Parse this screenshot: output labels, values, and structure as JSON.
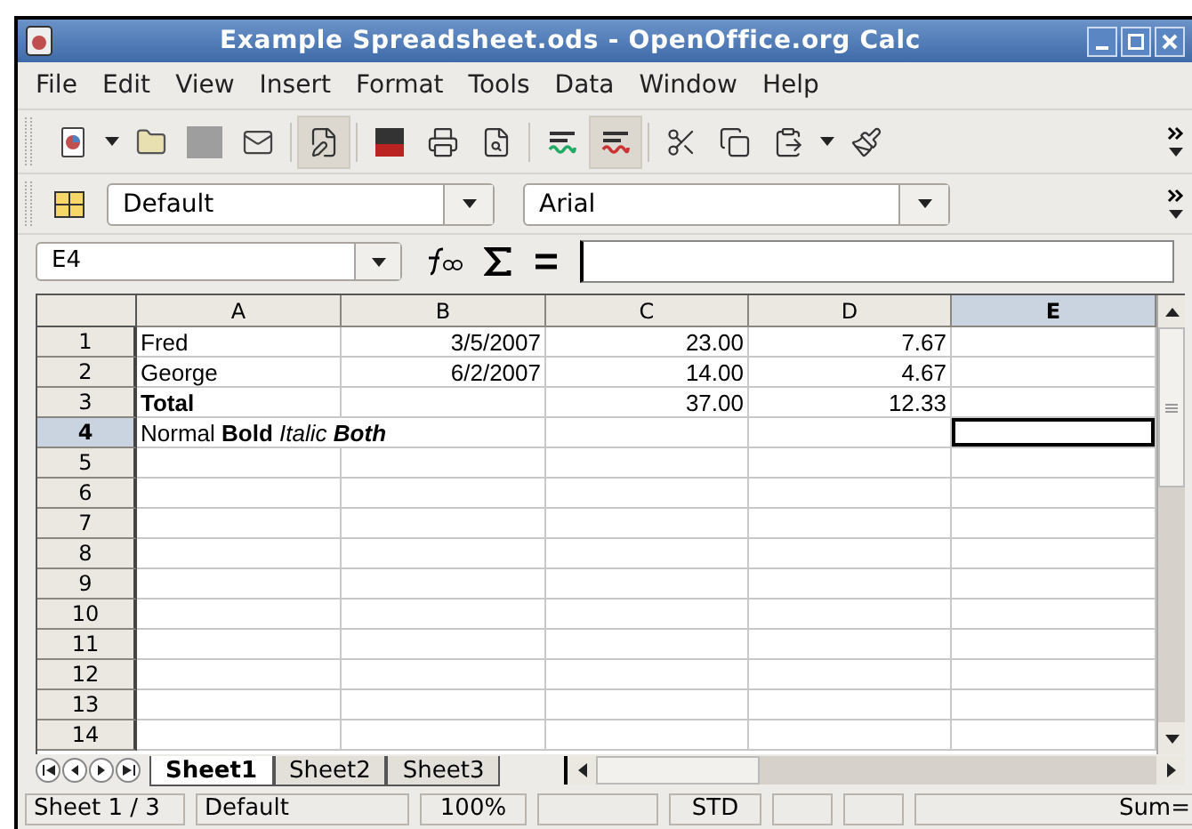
{
  "window": {
    "title": "Example Spreadsheet.ods - OpenOffice.org Calc"
  },
  "menu": [
    "File",
    "Edit",
    "View",
    "Insert",
    "Format",
    "Tools",
    "Data",
    "Window",
    "Help"
  ],
  "toolbar": [
    {
      "pressed": false
    },
    {
      "pressed": false
    },
    {
      "pressed": false
    },
    {
      "pressed": false
    },
    {
      "pressed": false
    },
    {
      "pressed": true
    },
    {
      "pressed": false
    },
    {
      "pressed": false
    },
    {
      "pressed": false
    },
    {
      "pressed": false
    },
    {
      "pressed": true
    },
    {
      "pressed": false
    },
    {
      "pressed": false
    },
    {
      "pressed": false
    },
    {
      "pressed": false
    },
    {
      "pressed": false
    }
  ],
  "format_bar": {
    "style": "Default",
    "font": "Arial"
  },
  "formula_bar": {
    "cell_ref": "E4"
  },
  "columns": [
    {
      "label": "A",
      "selected": false
    },
    {
      "label": "B",
      "selected": false
    },
    {
      "label": "C",
      "selected": false
    },
    {
      "label": "D",
      "selected": false
    },
    {
      "label": "E",
      "selected": true
    }
  ],
  "rows": [
    {
      "label": "1",
      "selected": false,
      "cells": [
        {
          "kind": "text",
          "text": "Fred"
        },
        {
          "kind": "number",
          "text": "3/5/2007"
        },
        {
          "kind": "number",
          "text": "23.00"
        },
        {
          "kind": "number",
          "text": "7.67"
        },
        null
      ]
    },
    {
      "label": "2",
      "selected": false,
      "cells": [
        {
          "kind": "text",
          "text": "George"
        },
        {
          "kind": "number",
          "text": "6/2/2007"
        },
        {
          "kind": "number",
          "text": "14.00"
        },
        {
          "kind": "number",
          "text": "4.67"
        },
        null
      ]
    },
    {
      "label": "3",
      "selected": false,
      "cells": [
        {
          "kind": "text",
          "text": "Total",
          "bold": true
        },
        null,
        {
          "kind": "number",
          "text": "37.00"
        },
        {
          "kind": "number",
          "text": "12.33"
        },
        null
      ]
    },
    {
      "label": "4",
      "selected": true,
      "cells": [
        {
          "kind": "runs",
          "runs": [
            {
              "text": "Normal",
              "bold": false,
              "italic": false
            },
            {
              "text": "Bold",
              "bold": true,
              "italic": false
            },
            {
              "text": "Italic",
              "bold": false,
              "italic": true
            },
            {
              "text": "Both",
              "bold": true,
              "italic": true
            }
          ]
        },
        null,
        null,
        null,
        {
          "kind": "cursor",
          "active": true
        }
      ]
    },
    {
      "label": "5",
      "selected": false,
      "cells": []
    },
    {
      "label": "6",
      "selected": false,
      "cells": []
    },
    {
      "label": "7",
      "selected": false,
      "cells": []
    },
    {
      "label": "8",
      "selected": false,
      "cells": []
    },
    {
      "label": "9",
      "selected": false,
      "cells": []
    },
    {
      "label": "10",
      "selected": false,
      "cells": []
    },
    {
      "label": "11",
      "selected": false,
      "cells": []
    },
    {
      "label": "12",
      "selected": false,
      "cells": []
    },
    {
      "label": "13",
      "selected": false,
      "cells": []
    },
    {
      "label": "14",
      "selected": false,
      "cells": []
    }
  ],
  "sheet_tabs": [
    {
      "label": "Sheet1",
      "selected": true
    },
    {
      "label": "Sheet2",
      "selected": false
    },
    {
      "label": "Sheet3",
      "selected": false
    }
  ],
  "status_bar": [
    {
      "kind": "text",
      "text": "Sheet 1 / 3"
    },
    {
      "kind": "text",
      "text": "Default"
    },
    {
      "kind": "center",
      "text": "100%"
    },
    {
      "kind": "blank"
    },
    {
      "kind": "center",
      "text": "STD"
    },
    {
      "kind": "blank"
    },
    {
      "kind": "blank"
    },
    {
      "kind": "right",
      "text": "Sum="
    }
  ]
}
